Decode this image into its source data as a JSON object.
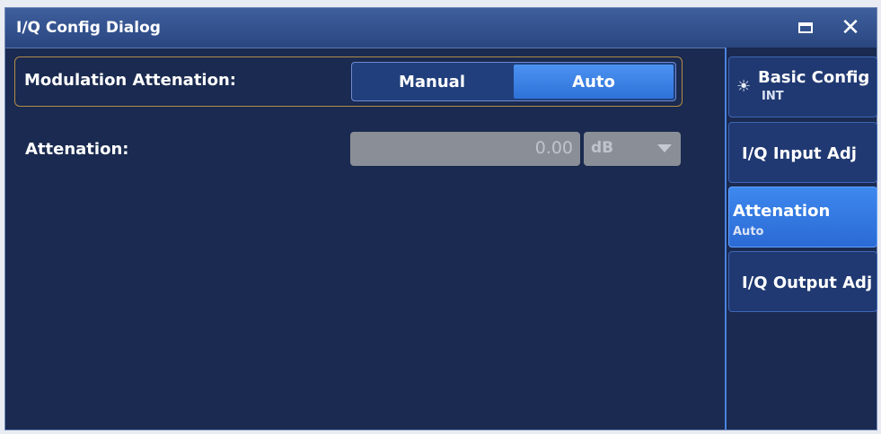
{
  "window": {
    "title": "I/Q Config Dialog",
    "maximize_icon": "maximize-icon",
    "close_icon": "close-icon",
    "close_glyph": "✕"
  },
  "modulation": {
    "label": "Modulation Attenation:",
    "options": [
      "Manual",
      "Auto"
    ],
    "selected": "Auto"
  },
  "attenuation": {
    "label": "Attenation:",
    "value": "0.00",
    "unit": "dB",
    "enabled": false
  },
  "sidebar": {
    "items": [
      {
        "title": "Basic Config",
        "subtitle": "INT",
        "icon": "sun-icon",
        "glyph": "☀"
      },
      {
        "title": "I/Q Input Adj",
        "subtitle": ""
      },
      {
        "title": "Attenation",
        "subtitle": "Auto",
        "active": true
      },
      {
        "title": "I/Q Output Adj",
        "subtitle": ""
      }
    ]
  },
  "colors": {
    "background": "#1a2a50",
    "titlebar": "#2a4680",
    "accent": "#3d88ee",
    "focus_border": "#b58b48",
    "disabled_field": "#8a8f97"
  }
}
